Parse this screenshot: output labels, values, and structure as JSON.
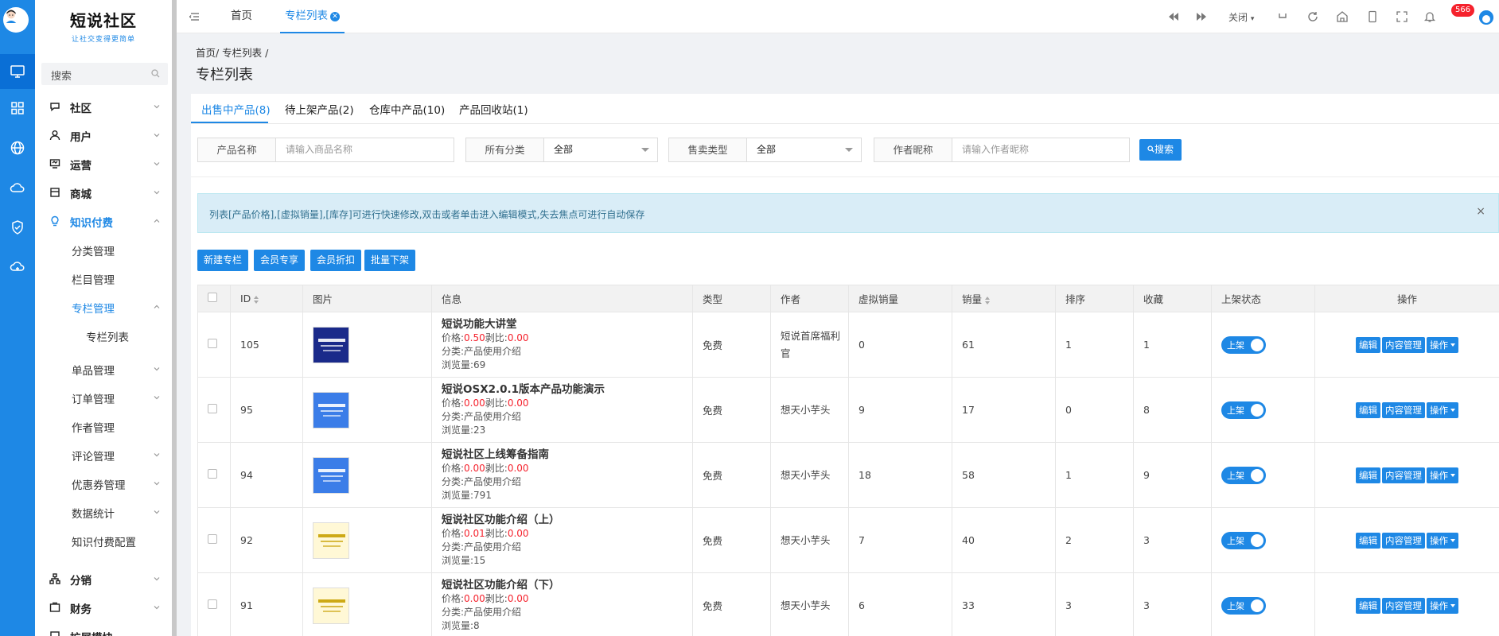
{
  "logo": {
    "title": "短说社区",
    "slogan": "让社交变得更简单"
  },
  "search": {
    "placeholder": "搜索"
  },
  "menu": [
    {
      "label": "社区"
    },
    {
      "label": "用户"
    },
    {
      "label": "运营"
    },
    {
      "label": "商城"
    },
    {
      "label": "知识付费"
    }
  ],
  "submenu": [
    {
      "label": "分类管理"
    },
    {
      "label": "栏目管理"
    },
    {
      "label": "专栏管理"
    },
    {
      "label": "专栏列表"
    },
    {
      "label": "单品管理"
    },
    {
      "label": "订单管理"
    },
    {
      "label": "作者管理"
    },
    {
      "label": "评论管理"
    },
    {
      "label": "优惠券管理"
    },
    {
      "label": "数据统计"
    },
    {
      "label": "知识付费配置"
    }
  ],
  "menu_bottom": [
    {
      "label": "分销"
    },
    {
      "label": "财务"
    },
    {
      "label": "扩展模块"
    }
  ],
  "topbar": {
    "tabs": [
      {
        "label": "首页"
      },
      {
        "label": "专栏列表"
      }
    ],
    "close_label": "关闭",
    "notif_count": "566"
  },
  "page": {
    "breadcrumb": "首页/ 专栏列表 /",
    "title": "专栏列表"
  },
  "product_tabs": [
    {
      "label": "出售中产品(8)"
    },
    {
      "label": "待上架产品(2)"
    },
    {
      "label": "仓库中产品(10)"
    },
    {
      "label": "产品回收站(1)"
    }
  ],
  "filters": {
    "name_label": "产品名称",
    "name_placeholder": "请输入商品名称",
    "category_label": "所有分类",
    "category_value": "全部",
    "sale_label": "售卖类型",
    "sale_value": "全部",
    "author_label": "作者昵称",
    "author_placeholder": "请输入作者昵称",
    "search_btn": "搜索"
  },
  "alert": {
    "text": "列表[产品价格],[虚拟销量],[库存]可进行快速修改,双击或者单击进入编辑模式,失去焦点可进行自动保存",
    "close": "×"
  },
  "actions": [
    "新建专栏",
    "会员专享",
    "会员折扣",
    "批量下架"
  ],
  "table": {
    "headers": {
      "id": "ID",
      "image": "图片",
      "info": "信息",
      "type": "类型",
      "author": "作者",
      "virtual_sales": "虚拟销量",
      "sales": "销量",
      "sort": "排序",
      "favorites": "收藏",
      "status": "上架状态",
      "ops": "操作"
    },
    "price_label": "价格:",
    "ratio_label": "剥比:",
    "category_label": "分类:",
    "views_label": "浏览量:",
    "status_on": "上架",
    "btn_edit": "编辑",
    "btn_content": "内容管理",
    "btn_more": "操作",
    "rows": [
      {
        "id": "105",
        "name": "短说功能大讲堂",
        "price": "0.50",
        "ratio": "0.00",
        "category": "产品使用介绍",
        "views": "69",
        "type": "免费",
        "author": "短说首席福利官",
        "virtual_sales": "0",
        "sales": "61",
        "sort": "1",
        "favorites": "1"
      },
      {
        "id": "95",
        "name": "短说OSX2.0.1版本产品功能演示",
        "price": "0.00",
        "ratio": "0.00",
        "category": "产品使用介绍",
        "views": "23",
        "type": "免费",
        "author": "想天小芋头",
        "virtual_sales": "9",
        "sales": "17",
        "sort": "0",
        "favorites": "8"
      },
      {
        "id": "94",
        "name": "短说社区上线筹备指南",
        "price": "0.00",
        "ratio": "0.00",
        "category": "产品使用介绍",
        "views": "791",
        "type": "免费",
        "author": "想天小芋头",
        "virtual_sales": "18",
        "sales": "58",
        "sort": "1",
        "favorites": "9"
      },
      {
        "id": "92",
        "name": "短说社区功能介绍（上）",
        "price": "0.01",
        "ratio": "0.00",
        "category": "产品使用介绍",
        "views": "15",
        "type": "免费",
        "author": "想天小芋头",
        "virtual_sales": "7",
        "sales": "40",
        "sort": "2",
        "favorites": "3"
      },
      {
        "id": "91",
        "name": "短说社区功能介绍（下）",
        "price": "0.00",
        "ratio": "0.00",
        "category": "产品使用介绍",
        "views": "8",
        "type": "免费",
        "author": "想天小芋头",
        "virtual_sales": "6",
        "sales": "33",
        "sort": "3",
        "favorites": "3"
      }
    ]
  },
  "colors": {
    "primary": "#1e88e5",
    "price_red": "#f5222d",
    "alert_bg": "#d9edf7"
  },
  "icons": {
    "icon_bar": [
      "monitor-icon",
      "apps-grid-icon",
      "globe-icon",
      "cloud-icon",
      "shield-check-icon",
      "cloud-sync-icon"
    ],
    "menu": [
      "chat-icon",
      "user-icon",
      "monitor-icon",
      "store-icon",
      "lightbulb-icon"
    ],
    "menu_bottom": [
      "hierarchy-icon",
      "wallet-icon",
      "puzzle-icon"
    ],
    "toolbar": [
      "rewind-icon",
      "fast-forward-icon",
      "undo-icon",
      "refresh-icon",
      "home-icon",
      "mobile-icon",
      "fullscreen-icon",
      "bell-icon"
    ]
  }
}
